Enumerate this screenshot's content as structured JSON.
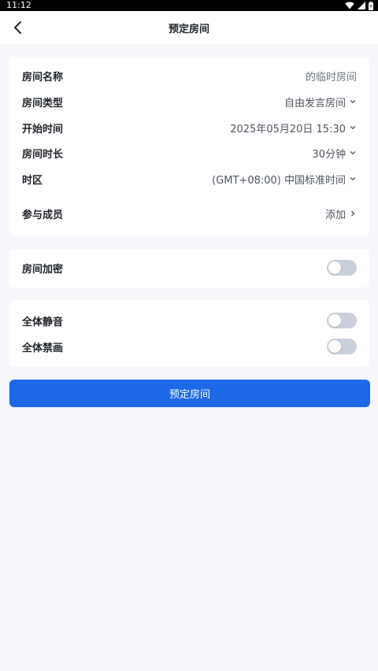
{
  "status_bar": {
    "time": "11:12"
  },
  "header": {
    "title": "预定房间"
  },
  "room": {
    "name": {
      "label": "房间名称",
      "value": "的临时房间"
    },
    "type": {
      "label": "房间类型",
      "value": "自由发言房间"
    },
    "start_time": {
      "label": "开始时间",
      "value": "2025年05月20日 15:30"
    },
    "duration": {
      "label": "房间时长",
      "value": "30分钟"
    },
    "timezone": {
      "label": "时区",
      "value": "(GMT+08:00) 中国标准时间"
    },
    "members": {
      "label": "参与成员",
      "value": "添加"
    }
  },
  "security": {
    "encrypt": {
      "label": "房间加密",
      "enabled": false
    }
  },
  "controls": {
    "mute_all": {
      "label": "全体静音",
      "enabled": false
    },
    "disable_video_all": {
      "label": "全体禁画",
      "enabled": false
    }
  },
  "actions": {
    "submit_label": "预定房间"
  },
  "colors": {
    "accent": "#1d68e6",
    "toggle_off": "#c9cedb",
    "background": "#f6f7fb"
  },
  "icons": {
    "back": "chevron-left-icon",
    "dropdown": "chevron-down-icon",
    "more": "chevron-right-icon"
  }
}
